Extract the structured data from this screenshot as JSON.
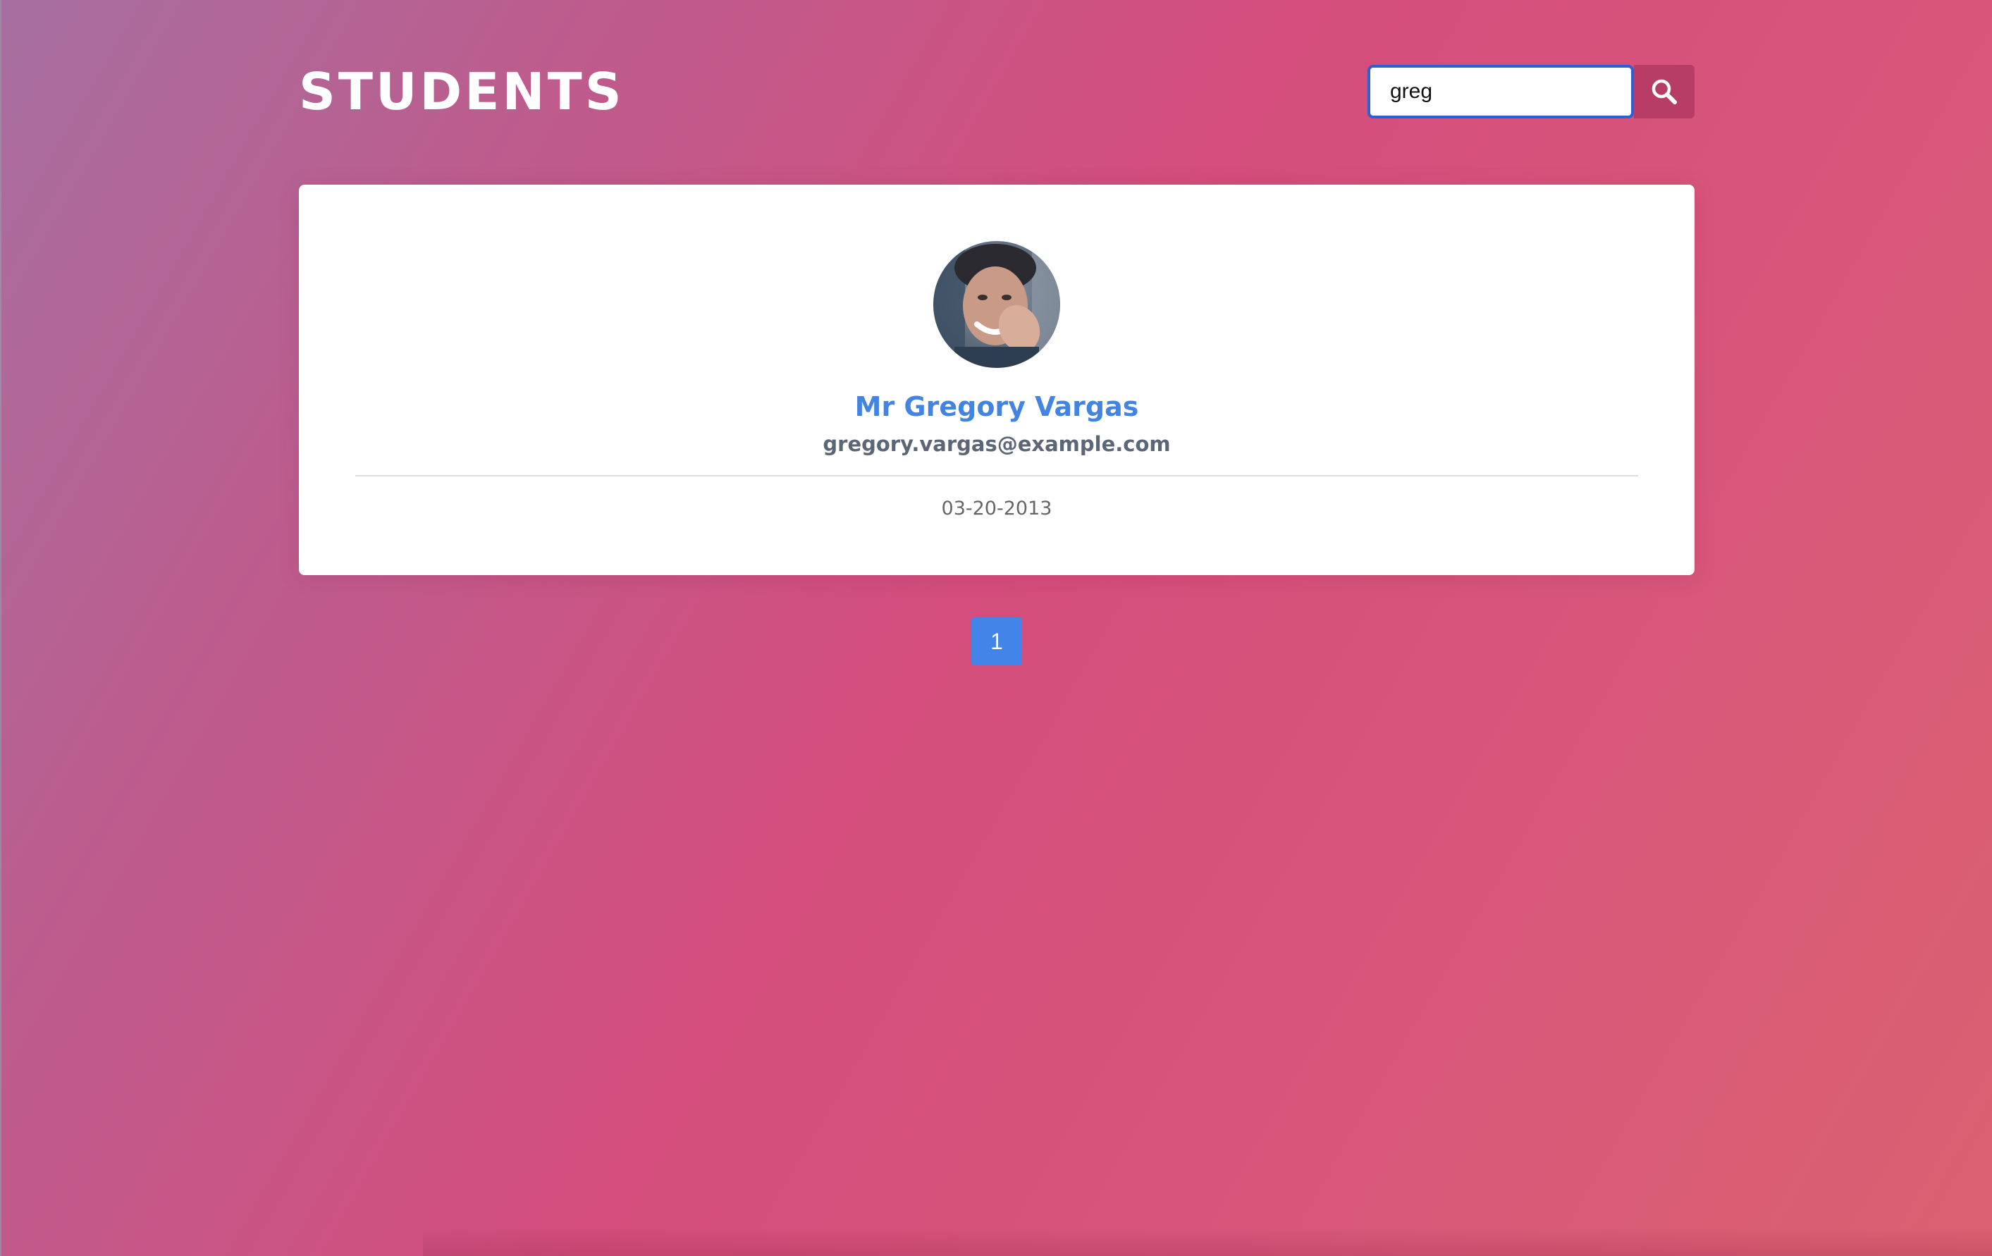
{
  "header": {
    "title": "STUDENTS"
  },
  "search": {
    "value": "greg",
    "button_icon": "search-icon"
  },
  "student": {
    "name": "Mr Gregory Vargas",
    "email": "gregory.vargas@example.com",
    "date": "03-20-2013",
    "avatar": "student-photo"
  },
  "pagination": {
    "current_page": "1"
  },
  "colors": {
    "name_link": "#4384e3",
    "pagination_active": "#4384e8",
    "search_button": "#b73d66",
    "input_focus_border": "#2f5fd0"
  }
}
